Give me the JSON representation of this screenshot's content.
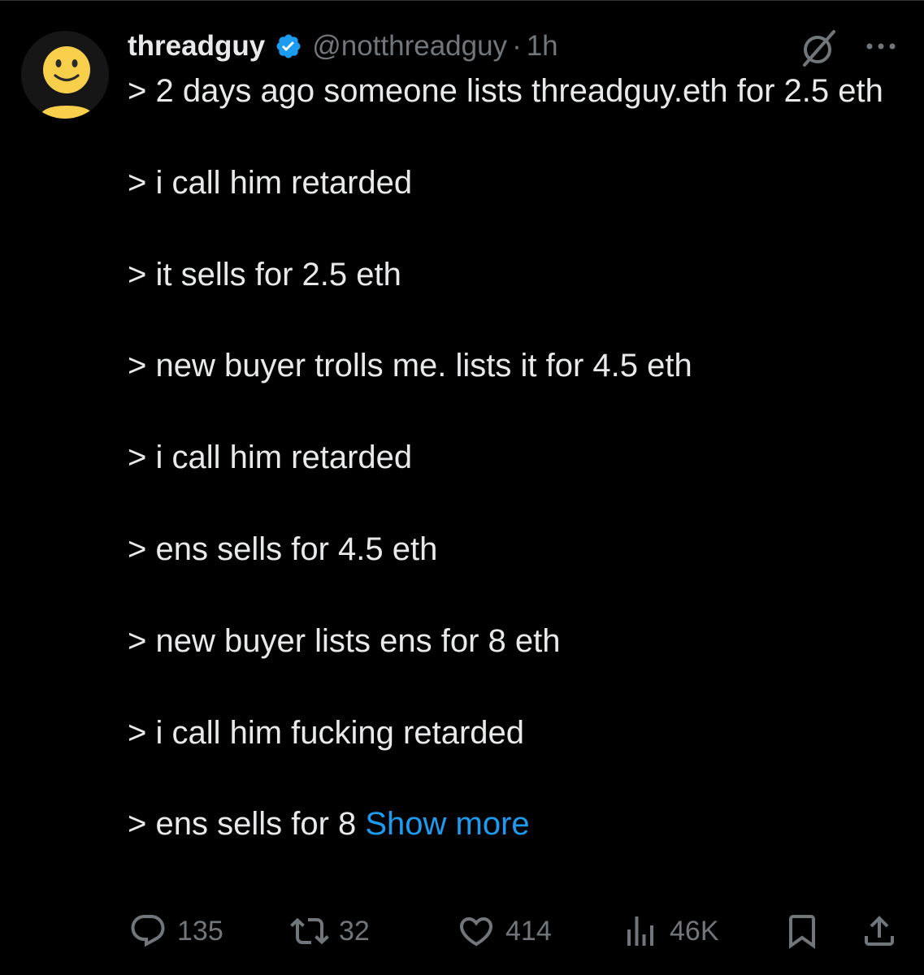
{
  "author": {
    "display_name": "threadguy",
    "handle": "@notthreadguy",
    "separator": "·",
    "time_ago": "1h",
    "verified_color": "#1d9bf0"
  },
  "tweet": {
    "lines": [
      "> 2 days ago someone lists threadguy.eth for 2.5 eth",
      "> i call him retarded",
      "> it sells for 2.5 eth",
      "> new buyer trolls me. lists it for 4.5 eth",
      "> i call him retarded",
      "> ens sells for 4.5 eth",
      "> new buyer lists ens for 8 eth",
      "> i call him fucking retarded"
    ],
    "last_line": "> ens sells for 8",
    "show_more_label": "Show more"
  },
  "actions": {
    "replies": "135",
    "reposts": "32",
    "likes": "414",
    "views": "46K"
  },
  "icons": {
    "avatar": "smiley-face-icon",
    "verified": "verified-badge-icon",
    "grok": "grok-icon",
    "more": "more-icon",
    "reply": "reply-icon",
    "repost": "repost-icon",
    "like": "heart-icon",
    "views": "analytics-icon",
    "bookmark": "bookmark-icon",
    "share": "share-icon"
  },
  "colors": {
    "background": "#000000",
    "text": "#e7e9ea",
    "secondary": "#71767b",
    "link": "#1d9bf0"
  }
}
